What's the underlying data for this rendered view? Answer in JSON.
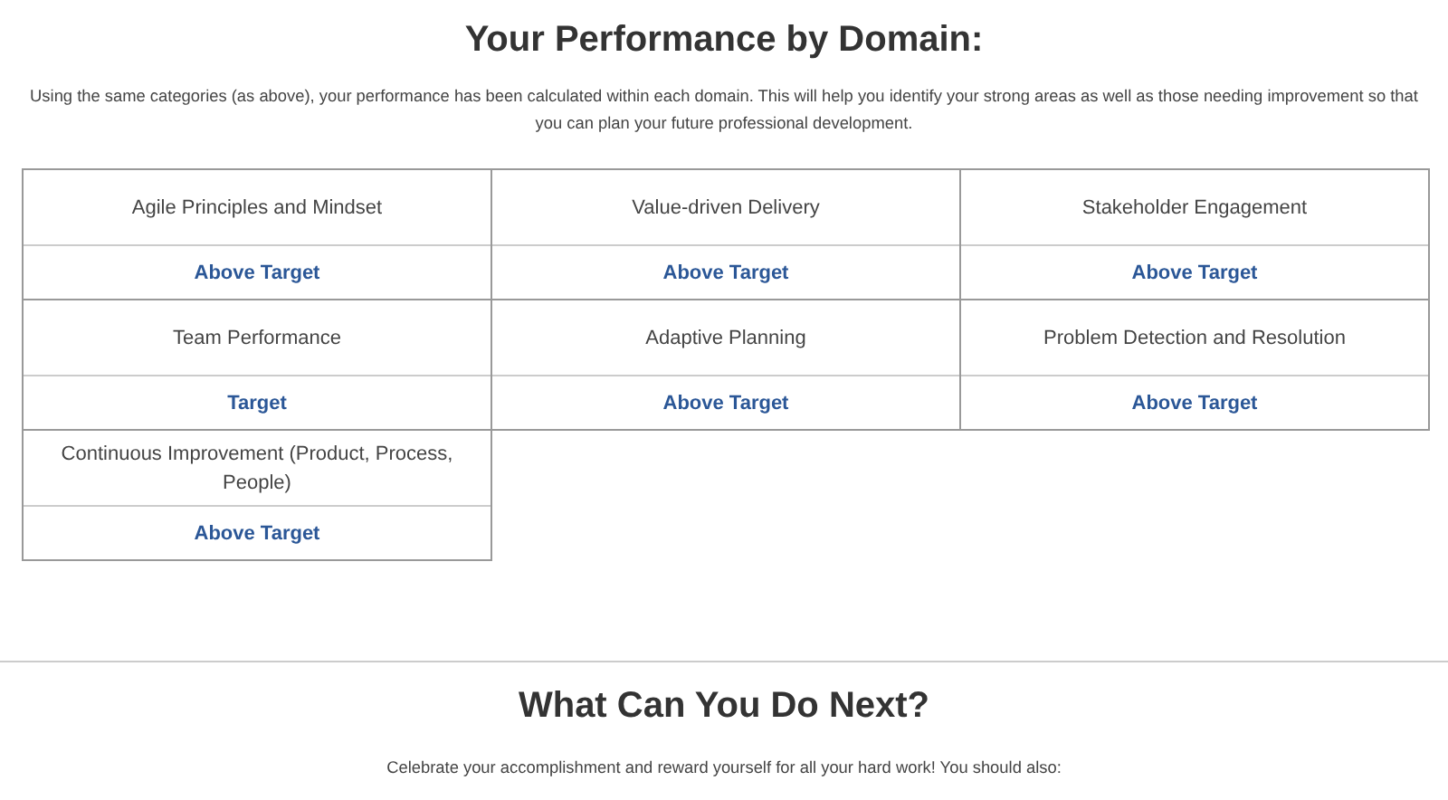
{
  "performance": {
    "title": "Your Performance by Domain:",
    "intro": "Using the same categories (as above), your performance has been calculated within each domain. This will help you identify your strong areas as well as those needing improvement so that you can plan your future professional development.",
    "domains": [
      {
        "name": "Agile Principles and Mindset",
        "rating": "Above Target"
      },
      {
        "name": "Value-driven Delivery",
        "rating": "Above Target"
      },
      {
        "name": "Stakeholder Engagement",
        "rating": "Above Target"
      },
      {
        "name": "Team Performance",
        "rating": "Target"
      },
      {
        "name": "Adaptive Planning",
        "rating": "Above Target"
      },
      {
        "name": "Problem Detection and Resolution",
        "rating": "Above Target"
      },
      {
        "name": "Continuous Improvement (Product, Process, People)",
        "rating": "Above Target"
      }
    ]
  },
  "next": {
    "title": "What Can You Do Next?",
    "intro": "Celebrate your accomplishment and reward yourself for all your hard work! You should also:"
  }
}
